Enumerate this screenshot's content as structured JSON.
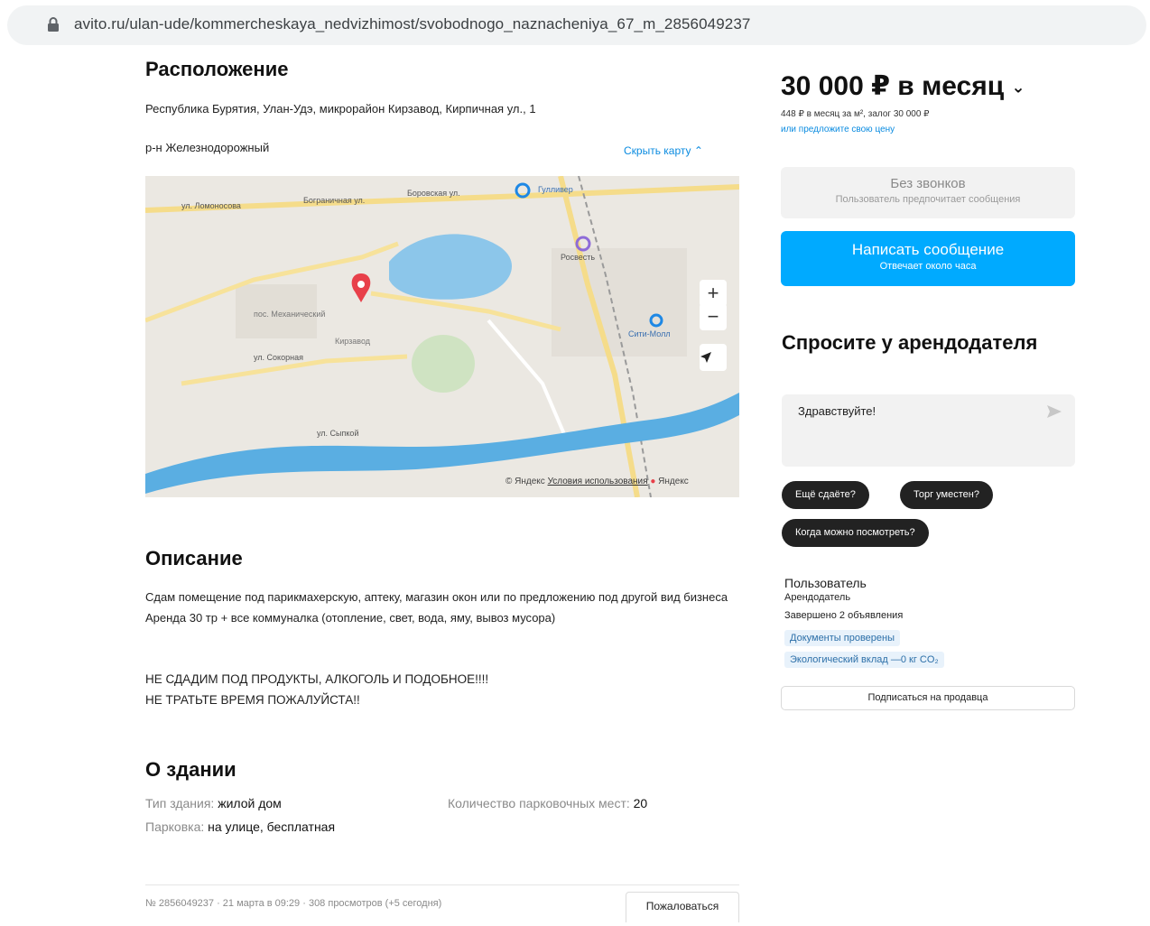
{
  "browser": {
    "url": "avito.ru/ulan-ude/kommercheskaya_nedvizhimost/svobodnogo_naznacheniya_67_m_2856049237"
  },
  "location": {
    "title": "Расположение",
    "address": "Республика Бурятия, Улан-Удэ, микрорайон Кирзавод, Кирпичная ул., 1",
    "district": "р-н Железнодорожный",
    "hide_map": "Скрыть карту",
    "map": {
      "copyright": "© Яндекс",
      "terms": "Условия использования",
      "brand": "Яндекс",
      "zoom_in": "+",
      "zoom_out": "−",
      "labels": {
        "poi1": "Гулливер",
        "poi2": "Росвесть",
        "poi3": "Сити-Молл",
        "street1": "ул. Ломоносова",
        "street2": "Бограничная ул.",
        "street3": "Боровская ул.",
        "street4": "ул. Сокорная",
        "street5": "ул. Сыпкой",
        "area1": "Кирзавод",
        "area2": "пос. Механический"
      }
    }
  },
  "description": {
    "title": "Описание",
    "lines": [
      "Сдам помещение под парикмахерскую, аптеку, магазин окон или по предложению под другой вид бизнеса",
      "Аренда 30 тр + все коммуналка (отопление, свет, вода, яму, вывоз мусора)"
    ],
    "caps": [
      "НЕ СДАДИМ ПОД ПРОДУКТЫ, АЛКОГОЛЬ И ПОДОБНОЕ!!!!",
      "НЕ ТРАТЬТЕ ВРЕМЯ ПОЖАЛУЙСТА!!"
    ]
  },
  "building": {
    "title": "О здании",
    "type_key": "Тип здания: ",
    "type_val": "жилой дом",
    "parking_key": "Парковка: ",
    "parking_val": "на улице, бесплатная",
    "spaces_key": "Количество парковочных мест: ",
    "spaces_val": "20"
  },
  "footer": {
    "info": "№ 2856049237 · 21 марта в 09:29 · 308 просмотров (+5 сегодня)",
    "complain": "Пожаловаться"
  },
  "sidebar": {
    "price": "30 000 ₽ в месяц",
    "price_sub": "448 ₽ в месяц за м², залог 30 000 ₽",
    "price_offer": "или предложите свою цену",
    "no_calls": "Без звонков",
    "no_calls_sub": "Пользователь предпочитает сообщения",
    "write": "Написать сообщение",
    "write_sub": "Отвечает около часа",
    "ask_title": "Спросите у арендодателя",
    "ask_text": "Здравствуйте!",
    "chips": [
      "Ещё сдаёте?",
      "Торг уместен?",
      "Когда можно посмотреть?"
    ],
    "seller_name": "Пользователь",
    "seller_role": "Арендодатель",
    "seller_ads": "Завершено 2 объявления",
    "badge_docs": "Документы проверены",
    "badge_eco": "Экологический вклад —0 кг CO₂",
    "subscribe": "Подписаться на продавца"
  },
  "colors": {
    "accent": "#00aaff",
    "link": "#0a8be0",
    "chip": "#222222",
    "marker": "#e8404a",
    "river": "#4aa6de"
  }
}
